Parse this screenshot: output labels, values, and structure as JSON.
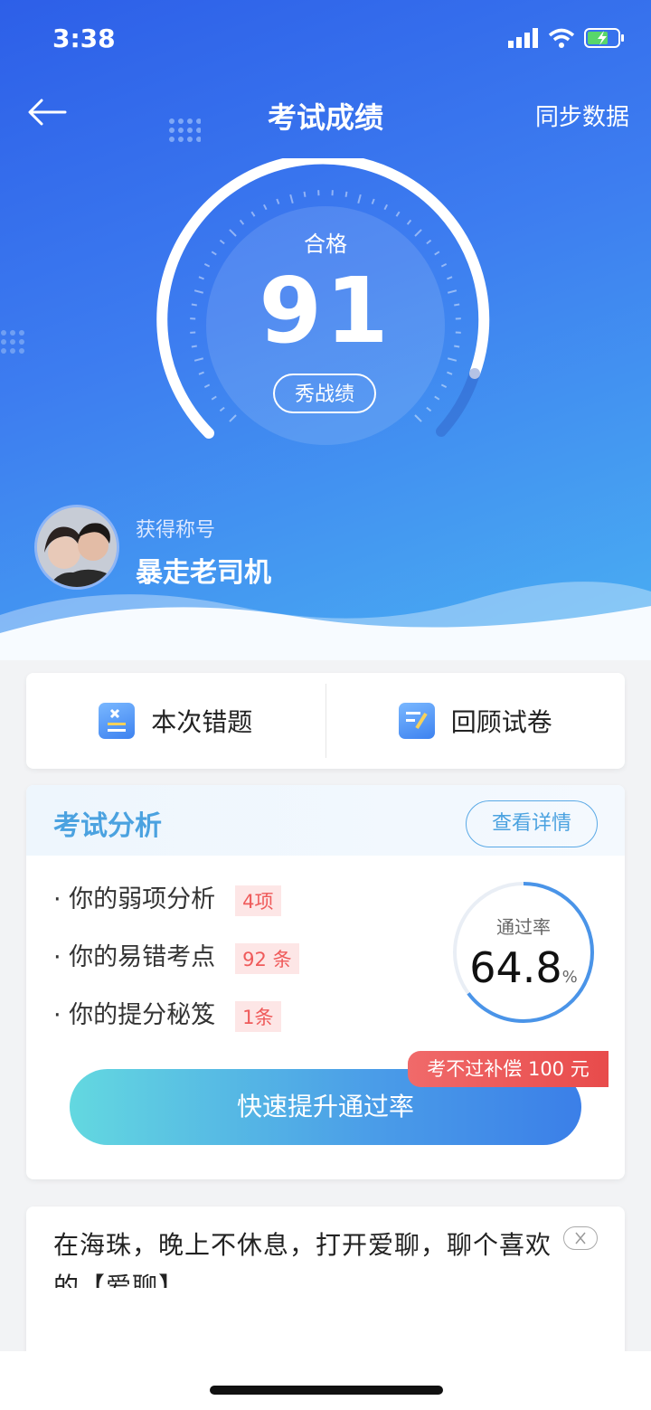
{
  "status": {
    "time": "3:38"
  },
  "nav": {
    "title": "考试成绩",
    "sync": "同步数据",
    "back_icon": "arrow-left-icon"
  },
  "gauge": {
    "status": "合格",
    "score": "91",
    "share": "秀战绩"
  },
  "profile": {
    "label": "获得称号",
    "title": "暴走老司机"
  },
  "actions": {
    "wrong": "本次错题",
    "review": "回顾试卷"
  },
  "analysis": {
    "title": "考试分析",
    "detail": "查看详情",
    "items": [
      {
        "label": "· 你的弱项分析",
        "tag": "4项"
      },
      {
        "label": "· 你的易错考点",
        "tag": "92 条"
      },
      {
        "label": "· 你的提分秘笈",
        "tag": "1条"
      }
    ],
    "rate_label": "通过率",
    "rate_value": "64.8",
    "rate_unit": "%",
    "cta": "快速提升通过率",
    "badge": "考不过补偿 100 元"
  },
  "ad": {
    "text": "在海珠，晚上不休息，打开爱聊，聊个喜欢的【爱聊】"
  },
  "colors": {
    "primary": "#3d7df0",
    "accent": "#4ba2e0",
    "danger": "#e84b4b"
  }
}
